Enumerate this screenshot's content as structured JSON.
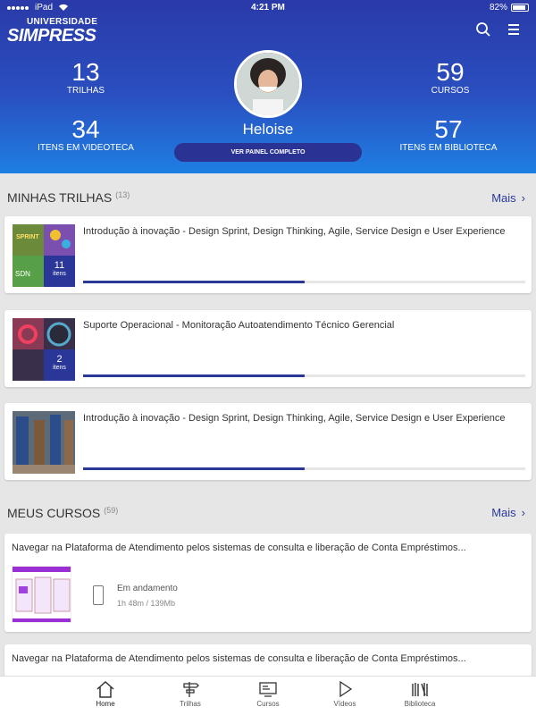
{
  "statusbar": {
    "left_text": "iPad",
    "time": "4:21 PM",
    "battery": "82%"
  },
  "brand": {
    "line1": "UNIVERSIDADE",
    "line2": "SIMPRESS"
  },
  "header": {
    "search_icon": "search-icon",
    "menu_icon": "menu-icon"
  },
  "profile": {
    "name": "Heloise",
    "button": "VER PAINEL COMPLETO",
    "stats": [
      {
        "value": "13",
        "label": "TRILHAS"
      },
      {
        "value": "34",
        "label": "ITENS EM VIDEOTECA"
      },
      {
        "value": "59",
        "label": "CURSOS"
      },
      {
        "value": "57",
        "label": "ITENS EM BIBLIOTECA"
      }
    ]
  },
  "trails": {
    "title": "MINHAS TRILHAS",
    "count": "(13)",
    "more": "Mais",
    "items": [
      {
        "title": "Introdução à inovação - Design Sprint, Design Thinking, Agile, Service Design e User Experience",
        "count": "11",
        "count_label": "itens",
        "progress": 0.5
      },
      {
        "title": "Suporte Operacional - Monitoração Autoatendimento Técnico Gerencial",
        "count": "2",
        "count_label": "itens",
        "progress": 0.5
      },
      {
        "title": "Introdução à inovação - Design Sprint, Design Thinking, Agile, Service Design e User Experience",
        "progress": 0.5
      }
    ]
  },
  "courses": {
    "title": "MEUS CURSOS",
    "count": "(59)",
    "more": "Mais",
    "items": [
      {
        "title": "Navegar na Plataforma de Atendimento pelos sistemas de consulta e liberação de Conta Empréstimos...",
        "status": "Em andamento",
        "meta": "1h 48m  /  139Mb"
      },
      {
        "title": "Navegar na Plataforma de Atendimento pelos sistemas de consulta e liberação de Conta Empréstimos..."
      }
    ]
  },
  "tabs": [
    {
      "label": "Home",
      "icon": "home-icon",
      "active": true
    },
    {
      "label": "Trilhas",
      "icon": "signpost-icon"
    },
    {
      "label": "Cursos",
      "icon": "course-screen-icon"
    },
    {
      "label": "Vídeos",
      "icon": "play-icon"
    },
    {
      "label": "Biblioteca",
      "icon": "books-icon"
    }
  ],
  "colors": {
    "primary": "#2a3799",
    "hero_top": "#2a3aa8",
    "hero_bottom": "#1e7fe3",
    "link": "#2a3a9c"
  }
}
